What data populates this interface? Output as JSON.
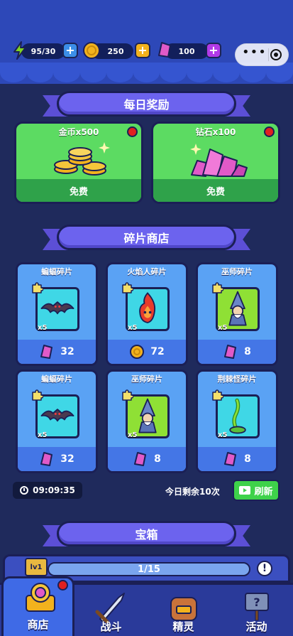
{
  "resources": {
    "energy": {
      "value": "95/30",
      "icon": "lightning-icon"
    },
    "coins": {
      "value": "250",
      "icon": "coin-icon"
    },
    "gems": {
      "value": "100",
      "icon": "gem-icon"
    }
  },
  "sections": {
    "daily": "每日奖励",
    "shard_shop": "碎片商店",
    "chest": "宝箱"
  },
  "daily_rewards": [
    {
      "title": "金币x500",
      "button": "免费",
      "icon": "coin-stack-icon"
    },
    {
      "title": "钻石x100",
      "button": "免费",
      "icon": "gem-pile-icon"
    }
  ],
  "shards": [
    {
      "name": "蝙蝠碎片",
      "qty": "x5",
      "price": "32",
      "currency": "gem",
      "tile": "cyan",
      "creature": "bat"
    },
    {
      "name": "火焰人碎片",
      "qty": "x5",
      "price": "72",
      "currency": "coin",
      "tile": "cyan",
      "creature": "fire"
    },
    {
      "name": "巫师碎片",
      "qty": "x5",
      "price": "8",
      "currency": "gem",
      "tile": "green",
      "creature": "wizard"
    },
    {
      "name": "蝙蝠碎片",
      "qty": "x5",
      "price": "32",
      "currency": "gem",
      "tile": "cyan",
      "creature": "bat"
    },
    {
      "name": "巫师碎片",
      "qty": "x5",
      "price": "8",
      "currency": "gem",
      "tile": "green",
      "creature": "wizard"
    },
    {
      "name": "荆棘怪碎片",
      "qty": "x5",
      "price": "8",
      "currency": "gem",
      "tile": "cyan",
      "creature": "thorn"
    }
  ],
  "shop_footer": {
    "timer": "09:09:35",
    "remaining": "今日剩余10次",
    "refresh": "刷新"
  },
  "chest": {
    "level": "lv1",
    "progress": "1/15",
    "progress_fraction": 0.067
  },
  "tabs": [
    {
      "label": "商店",
      "icon": "shop-icon",
      "active": true
    },
    {
      "label": "战斗",
      "icon": "sword-icon",
      "active": false
    },
    {
      "label": "精灵",
      "icon": "backpack-icon",
      "active": false
    },
    {
      "label": "活动",
      "icon": "sign-icon",
      "active": false
    }
  ],
  "colors": {
    "gem": "#e15ac8",
    "coin": "#f2b21d",
    "energy": "#7ed321",
    "accent": "#6c63ee"
  }
}
